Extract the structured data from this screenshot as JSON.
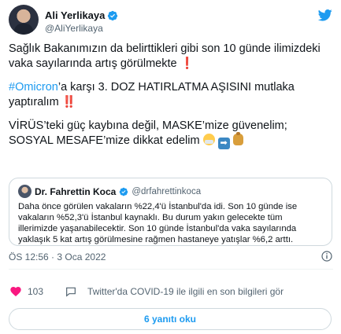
{
  "user": {
    "name": "Ali Yerlikaya",
    "handle": "@AliYerlikaya"
  },
  "tweet": {
    "p1": "Sağlık Bakanımızın da belirttikleri gibi son 10 günde ilimizdeki vaka sayılarında artış görülmekte",
    "p1_emoji": "❗",
    "p2_tag": "#Omicron",
    "p2_text": "’a karşı 3. DOZ HATIRLATMA AŞISINI mutlaka yaptıralım",
    "p2_emoji": "‼️",
    "p3_line1": "VİRÜS’teki güç kaybına değil, MASKE’mize güvenelim;",
    "p3_line2": "SOSYAL MESAFE’mize dikkat edelim",
    "p3_emojis": [
      "mask-face-emoji",
      "arrow-right-emoji",
      "money-bag-emoji"
    ]
  },
  "quoted": {
    "name": "Dr. Fahrettin Koca",
    "handle": "@drfahrettinkoca",
    "text": "Daha önce görülen vakaların %22,4'ü İstanbul'da idi. Son 10 günde ise vakaların %52,3'ü İstanbul kaynaklı. Bu durum yakın gelecekte tüm illerimizde yaşanabilecektir. Son 10 günde İstanbul'da vaka sayılarında yaklaşık 5 kat artış görülmesine rağmen hastaneye yatışlar %6,2 arttı."
  },
  "meta": {
    "timestamp": "ÖS 12:56 · 3 Oca 2022"
  },
  "actions": {
    "like_count": "103",
    "covid_link": "Twitter'da COVID-19 ile ilgili en son bilgileri gör"
  },
  "replies": {
    "label": "6 yanıtı oku"
  },
  "colors": {
    "accent": "#1d9bf0",
    "text": "#0f1419",
    "secondary": "#536471",
    "border": "#cfd9de"
  }
}
